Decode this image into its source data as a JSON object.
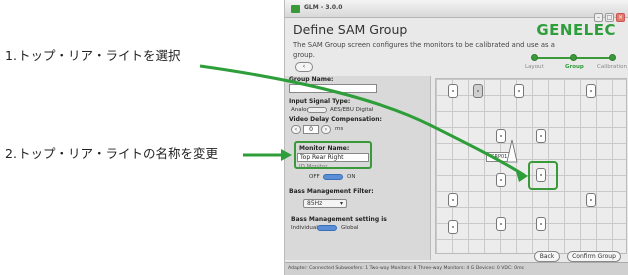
{
  "steps": [
    {
      "num": "1.",
      "text": "トップ・リア・ライトを選択"
    },
    {
      "num": "2.",
      "text": "トップ・リア・ライトの名称を変更"
    }
  ],
  "window": {
    "title": "GLM - 3.0.0",
    "controls": [
      "–",
      "□",
      "×"
    ]
  },
  "header": {
    "title": "Define SAM Group",
    "description": "The SAM Group screen configures the monitors to be calibrated and use as a group.",
    "brand": "GENELEC",
    "back_small": "‹",
    "progress": [
      "Layout",
      "Group",
      "Calibration"
    ],
    "progress_active": "Group"
  },
  "left": {
    "group_name_label": "Group Name:",
    "input_signal_label": "Input Signal Type:",
    "analog": "Analog",
    "digital": "AES/EBU Digital",
    "video_delay_label": "Video Delay Compensation:",
    "video_delay_value": "0",
    "video_delay_unit": "ms",
    "monitor_name_label": "Monitor Name:",
    "monitor_name_value": "Top Rear Right",
    "monitor_sub": "ID Monitor",
    "off": "OFF",
    "on": "ON",
    "bass_filter_label": "Bass Management Filter:",
    "bass_filter_value": "85Hz",
    "bass_setting_label": "Bass Management setting is",
    "individual": "Individual",
    "global": "Global"
  },
  "grid": {
    "group_tag": "GRP01"
  },
  "buttons": {
    "back": "Back",
    "confirm": "Confirm Group"
  },
  "status_bar": "Adapter: Connected  Subwoofers: 1   Two-way Monitors: 8   Three-way Monitors: 4   G Devices: 0   VDC: 0ms",
  "colors": {
    "accent": "#2e9e3a",
    "toggle_on": "#5a8fd8"
  }
}
